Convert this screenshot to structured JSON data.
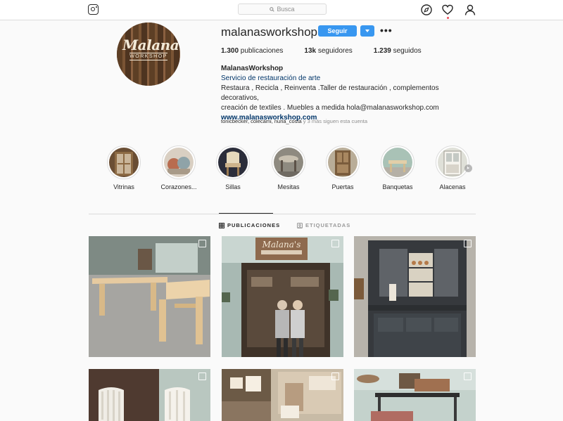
{
  "header": {
    "search_placeholder": "Busca"
  },
  "profile": {
    "avatar_text": "Malana's",
    "avatar_subtext": "WORKSHOP",
    "username": "malanasworkshop",
    "follow_label": "Seguir",
    "more_label": "•••",
    "stats": {
      "posts_value": "1.300",
      "posts_label": " publicaciones",
      "followers_value": "13k",
      "followers_label": " seguidores",
      "following_value": "1.239",
      "following_label": " seguidos"
    },
    "bio": {
      "name": "MalanasWorkshop",
      "category": "Servicio de restauración de arte",
      "line1": "Restaura , Recicla , Reinventa .Taller de restauración , complementos decorativos,",
      "line2": "creación de textiles . Muebles a medida hola@malanasworkshop.com",
      "link": "www.malanasworkshop.com"
    },
    "followed_by": "tonicbecker, colecami, nuria_costa",
    "followed_by_more": " y 3 más siguen esta cuenta"
  },
  "highlights": [
    {
      "label": "Vitrinas"
    },
    {
      "label": "Corazones..."
    },
    {
      "label": "Sillas"
    },
    {
      "label": "Mesitas"
    },
    {
      "label": "Puertas"
    },
    {
      "label": "Banquetas"
    },
    {
      "label": "Alacenas"
    }
  ],
  "tabs": {
    "posts": "PUBLICACIONES",
    "tagged": "ETIQUETADAS"
  },
  "colors": {
    "accent": "#3897f0",
    "text": "#262626",
    "muted": "#8e8e8e",
    "link": "#003569",
    "border": "#dbdbdb"
  }
}
